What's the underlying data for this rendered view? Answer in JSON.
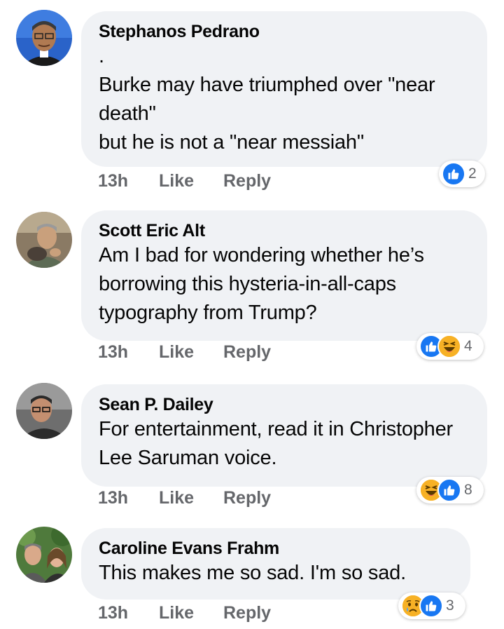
{
  "colors": {
    "bubble": "#f0f2f5",
    "like_blue": "#1877f2",
    "meta_text": "#65676b"
  },
  "comments": [
    {
      "author": "Stephanos Pedrano",
      "text": ".\nBurke may have triumphed over \"near death\"\nbut he is not a \"near messiah\"",
      "time": "13h",
      "like_label": "Like",
      "reply_label": "Reply",
      "reactions": [
        "like-icon"
      ],
      "reaction_count": "2"
    },
    {
      "author": "Scott Eric Alt",
      "text": "Am I bad for wondering whether he’s borrowing this hysteria-in-all-caps typography from Trump?",
      "time": "13h",
      "like_label": "Like",
      "reply_label": "Reply",
      "reactions": [
        "like-icon",
        "haha-icon"
      ],
      "reaction_count": "4"
    },
    {
      "author": "Sean P. Dailey",
      "text": "For entertainment, read it in Christopher Lee Saruman voice.",
      "time": "13h",
      "like_label": "Like",
      "reply_label": "Reply",
      "reactions": [
        "haha-icon",
        "like-icon"
      ],
      "reaction_count": "8"
    },
    {
      "author": "Caroline Evans Frahm",
      "text": "This makes me so sad. I'm so sad.",
      "time": "13h",
      "like_label": "Like",
      "reply_label": "Reply",
      "reactions": [
        "sad-icon",
        "like-icon"
      ],
      "reaction_count": "3"
    }
  ]
}
